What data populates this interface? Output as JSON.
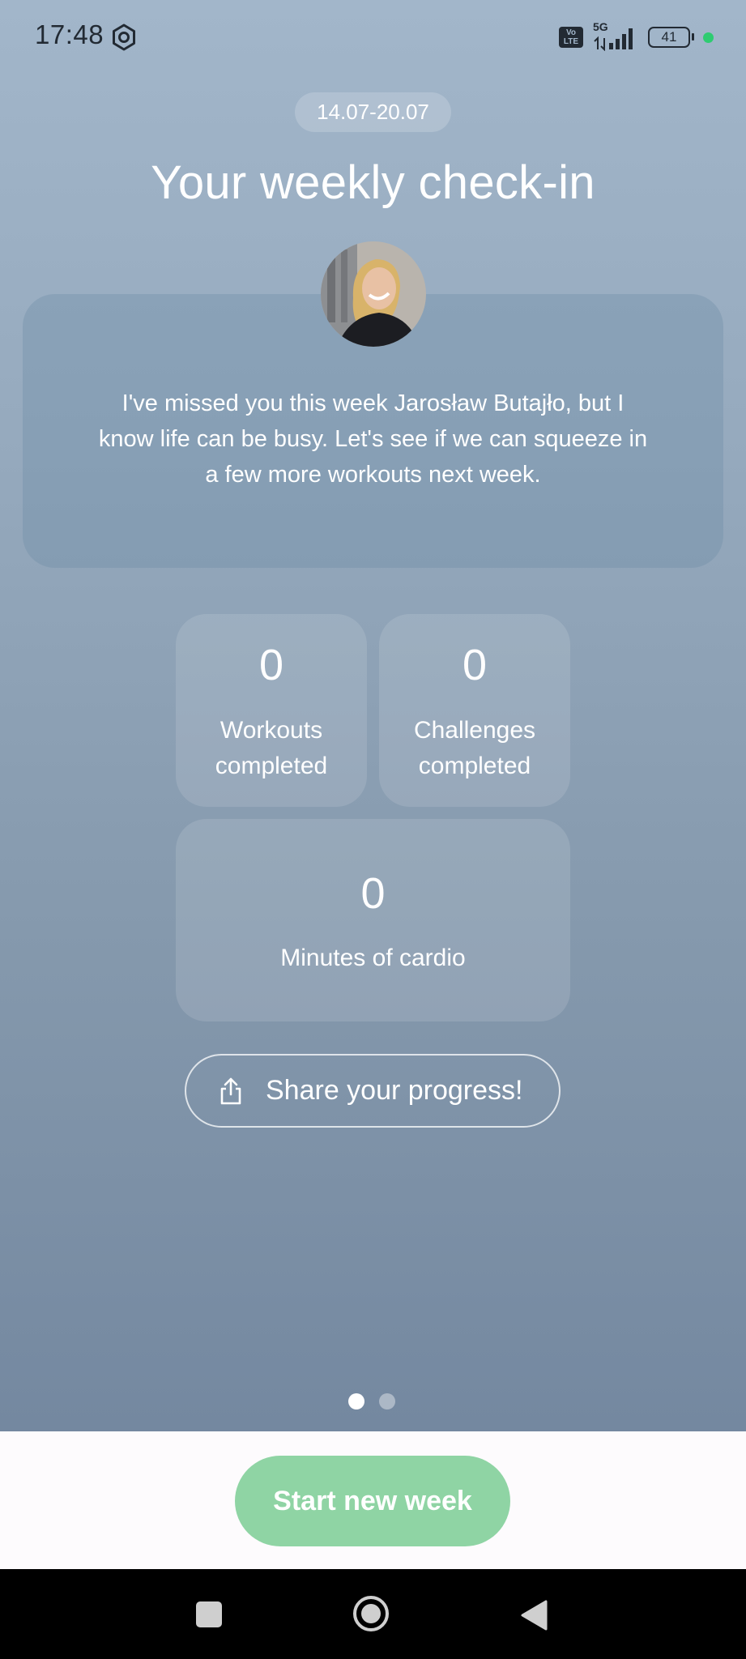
{
  "status_bar": {
    "time": "17:48",
    "network": "5G",
    "volte": "Vo LTE",
    "battery": "41"
  },
  "date_range": "14.07-20.07",
  "title": "Your weekly check-in",
  "message": "I've missed you this week Jarosław Butajło, but I know life can be busy. Let's see if we can squeeze in a few more workouts next week.",
  "stats": {
    "workouts": {
      "value": "0",
      "label_line1": "Workouts",
      "label_line2": "completed"
    },
    "challenges": {
      "value": "0",
      "label_line1": "Challenges",
      "label_line2": "completed"
    },
    "cardio": {
      "value": "0",
      "label": "Minutes of cardio"
    }
  },
  "share_button": {
    "label": "Share your progress!",
    "icon": "share-icon"
  },
  "pagination": {
    "current": 1,
    "total": 2
  },
  "start_button": {
    "label": "Start new week"
  },
  "colors": {
    "background_top": "#a2b6ca",
    "background_bottom": "#7488a0",
    "accent_green": "#8fd4a4",
    "status_dot": "#2ecc71"
  }
}
